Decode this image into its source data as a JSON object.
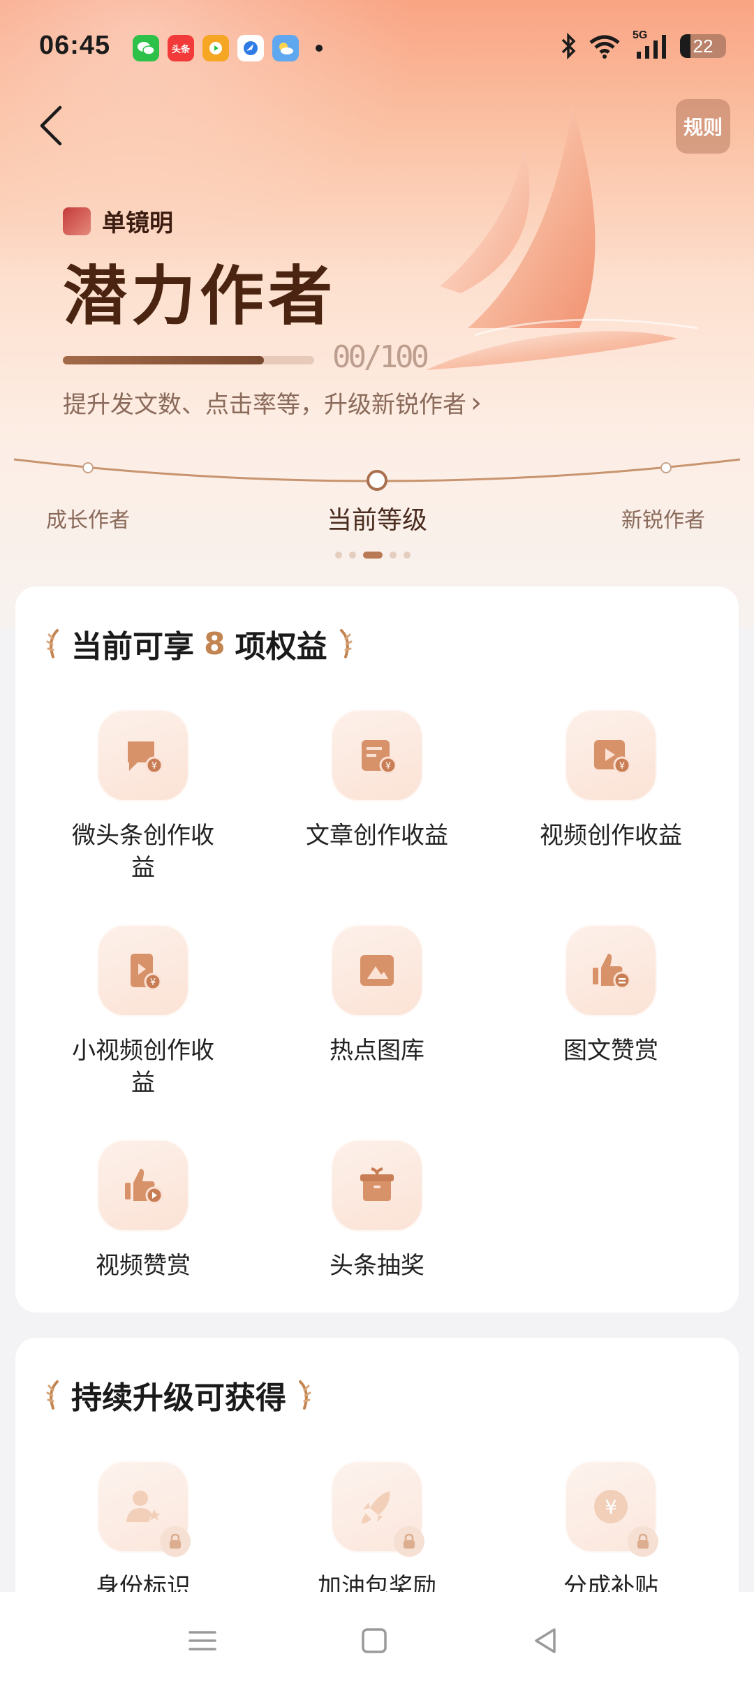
{
  "status_bar": {
    "time": "06:45",
    "notification_apps": [
      "wechat-icon",
      "toutiao-icon",
      "video-app-icon",
      "browser-icon",
      "weather-icon"
    ],
    "toutiao_label": "头条",
    "network": "5G",
    "battery": "22"
  },
  "header": {
    "back_icon": "chevron-left-icon",
    "rules_label": "规则"
  },
  "profile": {
    "username": "单镜明",
    "level_title": "潜力作者",
    "progress_fraction": 0.8,
    "progress_text": "00/100",
    "upgrade_hint": "提升发文数、点击率等，升级新锐作者",
    "upgrade_arrow": "›"
  },
  "levels": {
    "previous": "成长作者",
    "current": "当前等级",
    "next": "新锐作者",
    "page_count": 5,
    "active_page": 2
  },
  "benefits": {
    "title_prefix": "当前可享",
    "count": "8",
    "title_suffix": "项权益",
    "items": [
      {
        "label": "微头条创作收益",
        "icon": "chat-bubble-yuan-icon"
      },
      {
        "label": "文章创作收益",
        "icon": "document-yuan-icon"
      },
      {
        "label": "视频创作收益",
        "icon": "video-yuan-icon"
      },
      {
        "label": "小视频创作收益",
        "icon": "short-video-yuan-icon"
      },
      {
        "label": "热点图库",
        "icon": "image-gallery-icon"
      },
      {
        "label": "图文赞赏",
        "icon": "thumbs-up-text-icon"
      },
      {
        "label": "视频赞赏",
        "icon": "thumbs-up-video-icon"
      },
      {
        "label": "头条抽奖",
        "icon": "gift-box-icon"
      }
    ]
  },
  "upgrade_benefits": {
    "title": "持续升级可获得",
    "items": [
      {
        "label": "身份标识",
        "icon": "user-star-icon"
      },
      {
        "label": "加油包奖励",
        "icon": "rocket-icon"
      },
      {
        "label": "分成补贴",
        "icon": "yuan-coin-icon"
      }
    ]
  },
  "colors": {
    "accent": "#c28450",
    "title_brown": "#4a2410",
    "tile_bg": "#fbe2d5"
  },
  "nav": {
    "menu_icon": "menu-icon",
    "home_icon": "square-home-icon",
    "back_icon": "triangle-back-icon"
  }
}
